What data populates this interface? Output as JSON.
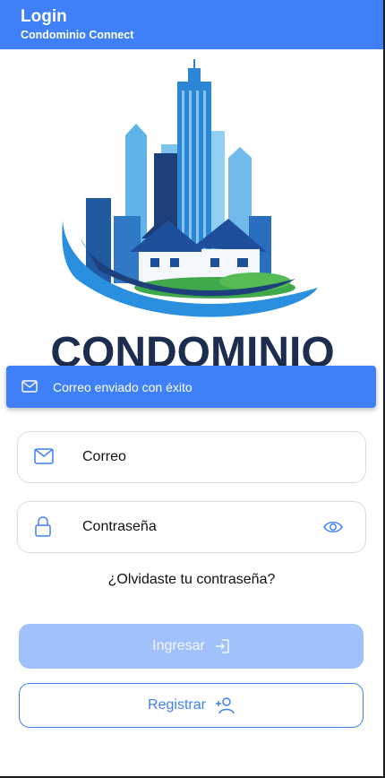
{
  "appbar": {
    "title": "Login",
    "subtitle": "Condominio Connect"
  },
  "logo": {
    "text": "CONDOMINIO",
    "icon": "building-house-logo"
  },
  "toast": {
    "message": "Correo enviado con éxito",
    "icon": "mail-icon"
  },
  "form": {
    "email": {
      "placeholder": "Correo",
      "icon": "mail-icon"
    },
    "password": {
      "placeholder": "Contraseña",
      "icon": "lock-icon",
      "toggle_icon": "eye-icon"
    },
    "forgot_label": "¿Olvidaste tu contraseña?",
    "login_label": "Ingresar",
    "register_label": "Registrar"
  },
  "colors": {
    "primary": "#3f80f9",
    "disabled": "#a0c1fb",
    "navy": "#1d2d4f"
  }
}
